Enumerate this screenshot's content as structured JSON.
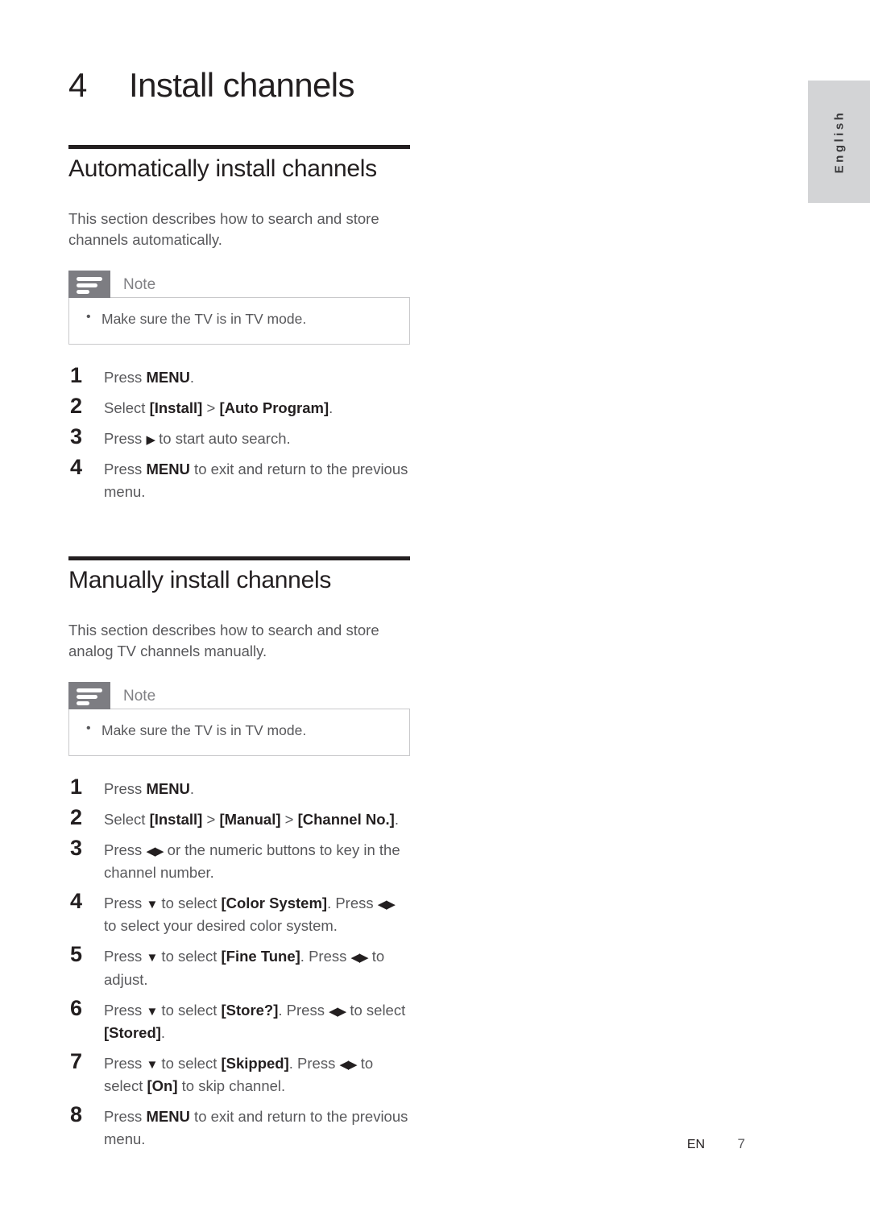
{
  "document": {
    "chapter_number": "4",
    "chapter_title": "Install channels",
    "language_tab": "English"
  },
  "sections": [
    {
      "title": "Automatically install channels",
      "intro": "This section describes how to search and store channels automatically.",
      "note": {
        "label": "Note",
        "items": [
          "Make sure the TV is in TV mode."
        ]
      },
      "steps": [
        {
          "num": "1",
          "text": "Press MENU."
        },
        {
          "num": "2",
          "text": "Select [Install] > [Auto Program]."
        },
        {
          "num": "3",
          "text": "Press ▶ to start auto search."
        },
        {
          "num": "4",
          "text": "Press MENU to exit and return to the previous menu."
        }
      ]
    },
    {
      "title": "Manually install channels",
      "intro": "This section describes how to search and store analog TV channels manually.",
      "note": {
        "label": "Note",
        "items": [
          "Make sure the TV is in TV mode."
        ]
      },
      "steps": [
        {
          "num": "1",
          "text": "Press MENU."
        },
        {
          "num": "2",
          "text": "Select [Install] > [Manual] > [Channel No.]."
        },
        {
          "num": "3",
          "text": "Press ◀▶ or the numeric buttons to key in the channel number."
        },
        {
          "num": "4",
          "text": "Press ▼ to select [Color System]. Press ◀▶ to select your desired color system."
        },
        {
          "num": "5",
          "text": "Press ▼ to select [Fine Tune]. Press ◀▶ to adjust."
        },
        {
          "num": "6",
          "text": "Press ▼ to select [Store?]. Press ◀▶ to select [Stored]."
        },
        {
          "num": "7",
          "text": "Press ▼ to select [Skipped]. Press ◀▶ to select [On] to skip channel."
        },
        {
          "num": "8",
          "text": "Press MENU to exit and return to the previous menu."
        }
      ]
    }
  ],
  "footer": {
    "language_code": "EN",
    "page_number": "7"
  },
  "colors": {
    "text_dark": "#231f20",
    "text_body": "#58585b",
    "note_icon_bg": "#7d7d82",
    "note_border": "#c9c9cb",
    "lang_tab_bg": "#d3d4d6"
  }
}
